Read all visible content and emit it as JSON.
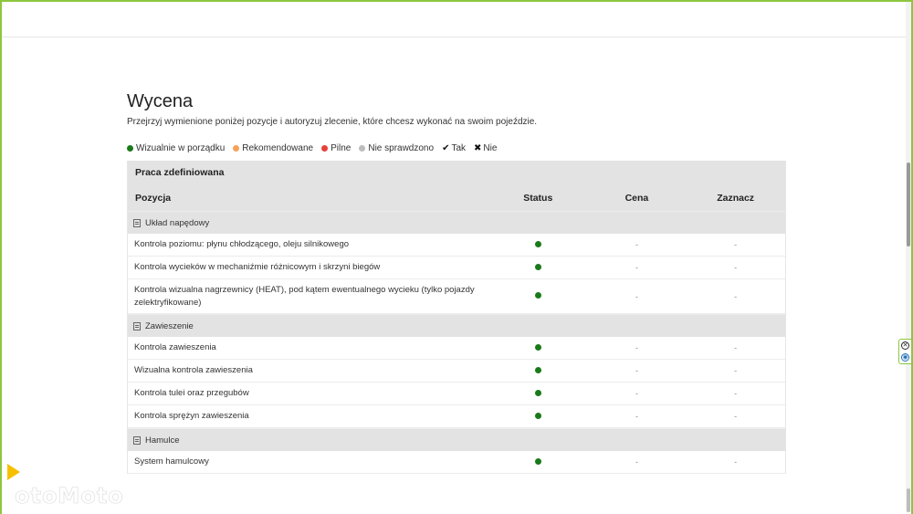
{
  "page": {
    "title": "Wycena",
    "subtitle": "Przejrzyj wymienione poniżej pozycje i autoryzuj zlecenie, które chcesz wykonać na swoim pojeździe."
  },
  "legend": [
    {
      "label": "Wizualnie w porządku",
      "color": "#1a7a1a",
      "kind": "dot"
    },
    {
      "label": "Rekomendowane",
      "color": "#f4a259",
      "kind": "dot"
    },
    {
      "label": "Pilne",
      "color": "#e8413a",
      "kind": "dot"
    },
    {
      "label": "Nie sprawdzono",
      "color": "#bdbdbd",
      "kind": "dot"
    },
    {
      "label": "Tak",
      "icon": "check-icon",
      "glyph": "✔",
      "kind": "glyph"
    },
    {
      "label": "Nie",
      "icon": "cross-icon",
      "glyph": "✖",
      "kind": "glyph"
    }
  ],
  "table": {
    "group_title": "Praca zdefiniowana",
    "headers": {
      "position": "Pozycja",
      "status": "Status",
      "price": "Cena",
      "select": "Zaznacz"
    },
    "sections": [
      {
        "name": "Układ napędowy",
        "rows": [
          {
            "label": "Kontrola poziomu: płynu chłodzącego, oleju silnikowego",
            "status_color": "#1a7a1a",
            "price": "-",
            "select": "-"
          },
          {
            "label": "Kontrola wycieków w mechaniźmie różnicowym i skrzyni biegów",
            "status_color": "#1a7a1a",
            "price": "-",
            "select": "-"
          },
          {
            "label": "Kontrola wizualna nagrzewnicy (HEAT), pod kątem ewentualnego wycieku (tylko pojazdy zelektryfikowane)",
            "status_color": "#1a7a1a",
            "price": "-",
            "select": "-"
          }
        ]
      },
      {
        "name": "Zawieszenie",
        "rows": [
          {
            "label": "Kontrola zawieszenia",
            "status_color": "#1a7a1a",
            "price": "-",
            "select": "-"
          },
          {
            "label": "Wizualna kontrola zawieszenia",
            "status_color": "#1a7a1a",
            "price": "-",
            "select": "-"
          },
          {
            "label": "Kontrola tulei oraz przegubów",
            "status_color": "#1a7a1a",
            "price": "-",
            "select": "-"
          },
          {
            "label": "Kontrola sprężyn zawieszenia",
            "status_color": "#1a7a1a",
            "price": "-",
            "select": "-"
          }
        ]
      },
      {
        "name": "Hamulce",
        "rows": [
          {
            "label": "System hamulcowy",
            "status_color": "#1a7a1a",
            "price": "-",
            "select": "-"
          }
        ]
      }
    ]
  },
  "widget": {
    "close_glyph": "✕",
    "info_glyph": "◉"
  },
  "watermark": {
    "text": "otoMoto"
  }
}
